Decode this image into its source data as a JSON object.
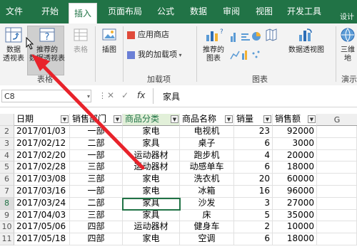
{
  "tabs": [
    "文件",
    "开始",
    "插入",
    "页面布局",
    "公式",
    "数据",
    "审阅",
    "视图",
    "开发工具"
  ],
  "ribbon": {
    "pivot_table": [
      "数据",
      "透视表"
    ],
    "recommended_pivot": [
      "推荐的",
      "数据透视表"
    ],
    "table": "表格",
    "group_tables": "表格",
    "illustrations": "插图",
    "app_store": "应用商店",
    "my_addins": "我的加载项",
    "group_addins": "加载项",
    "recommended_charts": [
      "推荐的",
      "图表"
    ],
    "pivot_chart": "数据透视图",
    "group_charts": "图表",
    "map3d": "三维地",
    "group_tours": "演示",
    "design": "设计"
  },
  "formula_bar": {
    "name_box": "C8",
    "fx": "fx",
    "value": "家具"
  },
  "columns": {
    "date": "日期",
    "dept": "销售部门",
    "category": "商品分类",
    "product": "商品名称",
    "qty": "销量",
    "sales": "销售额",
    "g": "G"
  },
  "rows": [
    {
      "num": "2",
      "date": "2017/01/03",
      "dept": "一部",
      "category": "家电",
      "product": "电视机",
      "qty": "23",
      "sales": "92000"
    },
    {
      "num": "3",
      "date": "2017/02/12",
      "dept": "二部",
      "category": "家具",
      "product": "桌子",
      "qty": "6",
      "sales": "3000"
    },
    {
      "num": "4",
      "date": "2017/02/20",
      "dept": "一部",
      "category": "运动器材",
      "product": "跑步机",
      "qty": "4",
      "sales": "20000"
    },
    {
      "num": "5",
      "date": "2017/02/28",
      "dept": "三部",
      "category": "运动器材",
      "product": "动感单车",
      "qty": "6",
      "sales": "18000"
    },
    {
      "num": "6",
      "date": "2017/03/08",
      "dept": "三部",
      "category": "家电",
      "product": "洗衣机",
      "qty": "20",
      "sales": "60000"
    },
    {
      "num": "7",
      "date": "2017/03/16",
      "dept": "一部",
      "category": "家电",
      "product": "冰箱",
      "qty": "16",
      "sales": "96000"
    },
    {
      "num": "8",
      "date": "2017/03/24",
      "dept": "二部",
      "category": "家具",
      "product": "沙发",
      "qty": "3",
      "sales": "27000"
    },
    {
      "num": "9",
      "date": "2017/04/03",
      "dept": "三部",
      "category": "家具",
      "product": "床",
      "qty": "5",
      "sales": "35000"
    },
    {
      "num": "10",
      "date": "2017/05/06",
      "dept": "四部",
      "category": "运动器材",
      "product": "健身车",
      "qty": "2",
      "sales": "10000"
    },
    {
      "num": "11",
      "date": "2017/05/18",
      "dept": "四部",
      "category": "家电",
      "product": "空调",
      "qty": "6",
      "sales": "18000"
    }
  ]
}
